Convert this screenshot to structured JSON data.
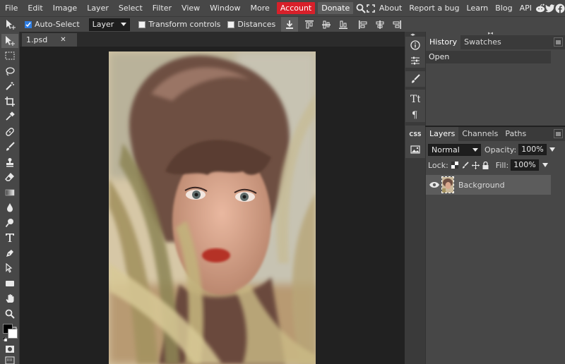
{
  "menu": {
    "items": [
      "File",
      "Edit",
      "Image",
      "Layer",
      "Select",
      "Filter",
      "View",
      "Window",
      "More"
    ],
    "account": "Account",
    "donate": "Donate",
    "right_links": [
      "About",
      "Report a bug",
      "Learn",
      "Blog",
      "API"
    ],
    "accent_account": "#d8202a"
  },
  "options": {
    "auto_select_label": "Auto-Select",
    "auto_select_checked": true,
    "target_select": "Layer",
    "transform_controls_label": "Transform controls",
    "distances_label": "Distances"
  },
  "document": {
    "tab_name": "1.psd",
    "tab_close": "✕"
  },
  "panels": {
    "top_tabs": [
      "History",
      "Swatches"
    ],
    "history_items": [
      "Open"
    ],
    "bottom_tabs": [
      "Layers",
      "Channels",
      "Paths"
    ],
    "blend_mode": "Normal",
    "opacity_label": "Opacity:",
    "opacity_value": "100%",
    "lock_label": "Lock:",
    "fill_label": "Fill:",
    "fill_value": "100%",
    "layer_name": "Background",
    "iconcol_text_css": "CSS"
  }
}
